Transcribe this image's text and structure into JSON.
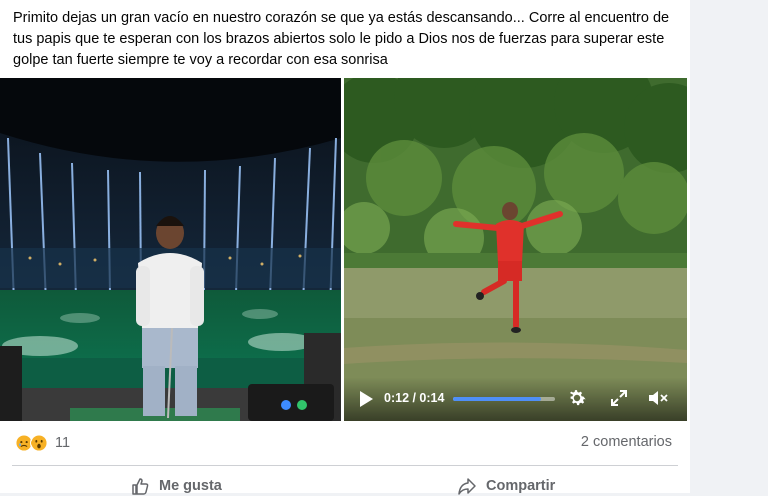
{
  "post": {
    "text": "Primito dejas un gran vacío en nuestro corazón se que ya estás descansando... Corre al encuentro de tus papis que te esperan con los brazos abiertos solo le pido a Dios nos de fuerzas para superar este golpe tan fuerte siempre te voy a recordar con esa sonrisa"
  },
  "video": {
    "time_display": "0:12 / 0:14",
    "progress": 0.86
  },
  "engagement": {
    "reaction_count": "11",
    "comments_label": "2 comentarios",
    "reaction_icons": [
      "sad-face-icon",
      "wow-face-icon"
    ]
  },
  "actions": {
    "like_label": "Me gusta",
    "share_label": "Compartir"
  },
  "colors": {
    "secondary_text": "#65676b",
    "progress_accent": "#4f8ff7",
    "reaction_yellow": "#f7b125"
  }
}
